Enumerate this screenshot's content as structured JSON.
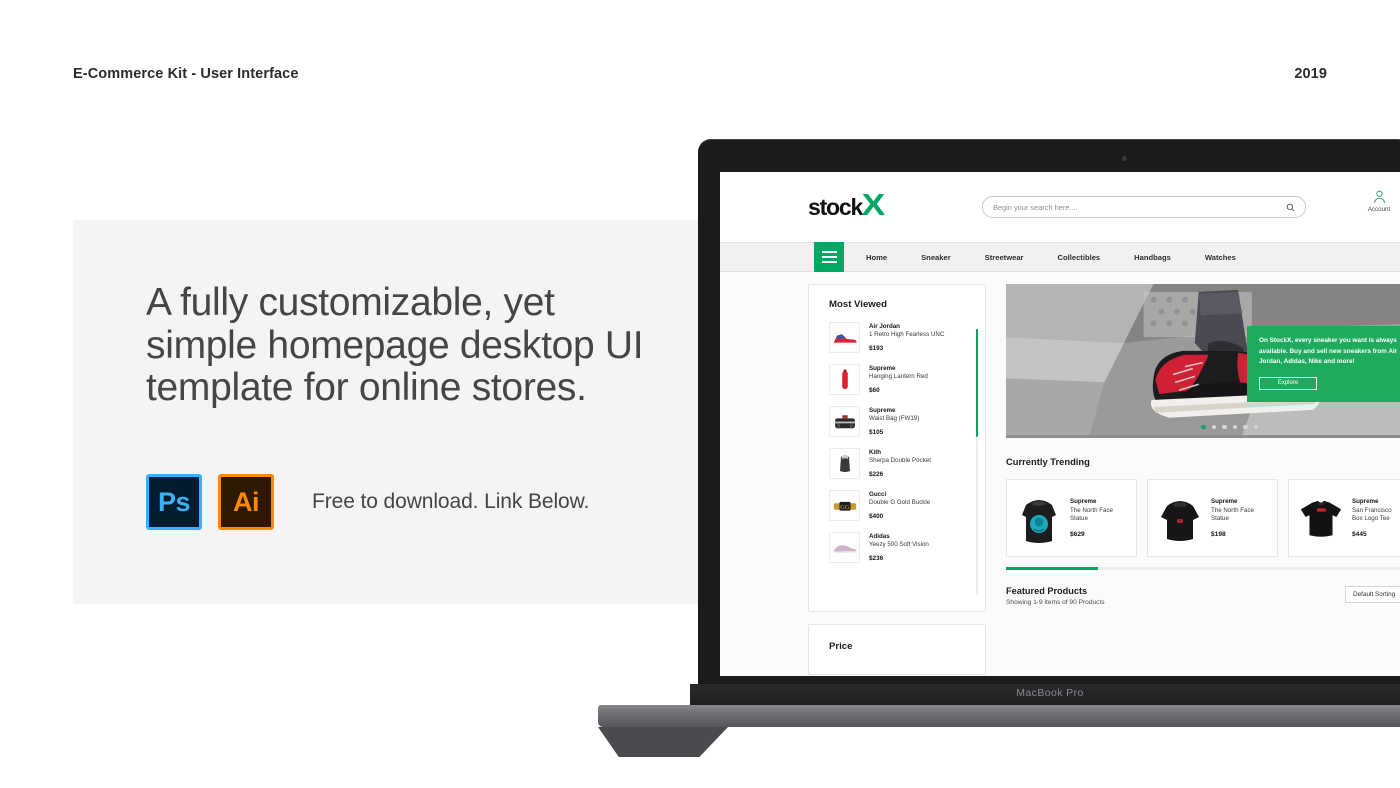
{
  "meta": {
    "title": "E-Commerce Kit - User Interface",
    "year": "2019"
  },
  "hero_panel": {
    "headline_line1": "A fully customizable, yet",
    "headline_line2": "simple homepage desktop UI",
    "headline_line3": "template for online stores.",
    "badge_ps": "Ps",
    "badge_ai": "Ai",
    "download_caption": "Free to download. Link Below."
  },
  "device": {
    "model_label": "MacBook Pro"
  },
  "site": {
    "logo_text": "stock",
    "logo_mark": "X",
    "accent_color": "#00a862",
    "search": {
      "placeholder": "Begin your search here....",
      "icon": "search-icon"
    },
    "account": {
      "label": "Account",
      "icon": "user-icon"
    },
    "nav": {
      "menu_icon": "hamburger-icon",
      "links": [
        {
          "label": "Home"
        },
        {
          "label": "Sneaker"
        },
        {
          "label": "Streetwear"
        },
        {
          "label": "Collectibles"
        },
        {
          "label": "Handbags"
        },
        {
          "label": "Watches"
        }
      ]
    },
    "sidebar": {
      "most_viewed_title": "Most Viewed",
      "price_title": "Price",
      "items": [
        {
          "brand": "Air Jordan",
          "name": "1 Retro High Fearless UNC",
          "price": "$193"
        },
        {
          "brand": "Supreme",
          "name": "Hanging Lantern Red",
          "price": "$60"
        },
        {
          "brand": "Supreme",
          "name": "Waist Bag (FW19)",
          "price": "$105"
        },
        {
          "brand": "Kith",
          "name": "Sherpa Double Pocket",
          "price": "$226"
        },
        {
          "brand": "Gucci",
          "name": "Double G Gold Buckle",
          "price": "$400"
        },
        {
          "brand": "Adidas",
          "name": "Yeezy 500 Soft Vision",
          "price": "$236"
        }
      ]
    },
    "banner": {
      "text": "On StockX, every sneaker you want is always available. Buy and sell new sneakers from Air Jordan, Adidas, Nike and more!",
      "button_label": "Explore",
      "dots_total": 6,
      "dots_active_index": 0
    },
    "trending": {
      "title": "Currently Trending",
      "cards": [
        {
          "brand": "Supreme",
          "name_line1": "The North Face",
          "name_line2": "Statue",
          "price": "$629"
        },
        {
          "brand": "Supreme",
          "name_line1": "The North Face",
          "name_line2": "Statue",
          "price": "$198"
        },
        {
          "brand": "Supreme",
          "name_line1": "San Francisco",
          "name_line2": "Box Logo Tee",
          "price": "$445"
        }
      ]
    },
    "featured": {
      "title": "Featured Products",
      "subtitle": "Showing 1-9 items of 90 Products",
      "sort_value": "Default Sorting"
    }
  }
}
